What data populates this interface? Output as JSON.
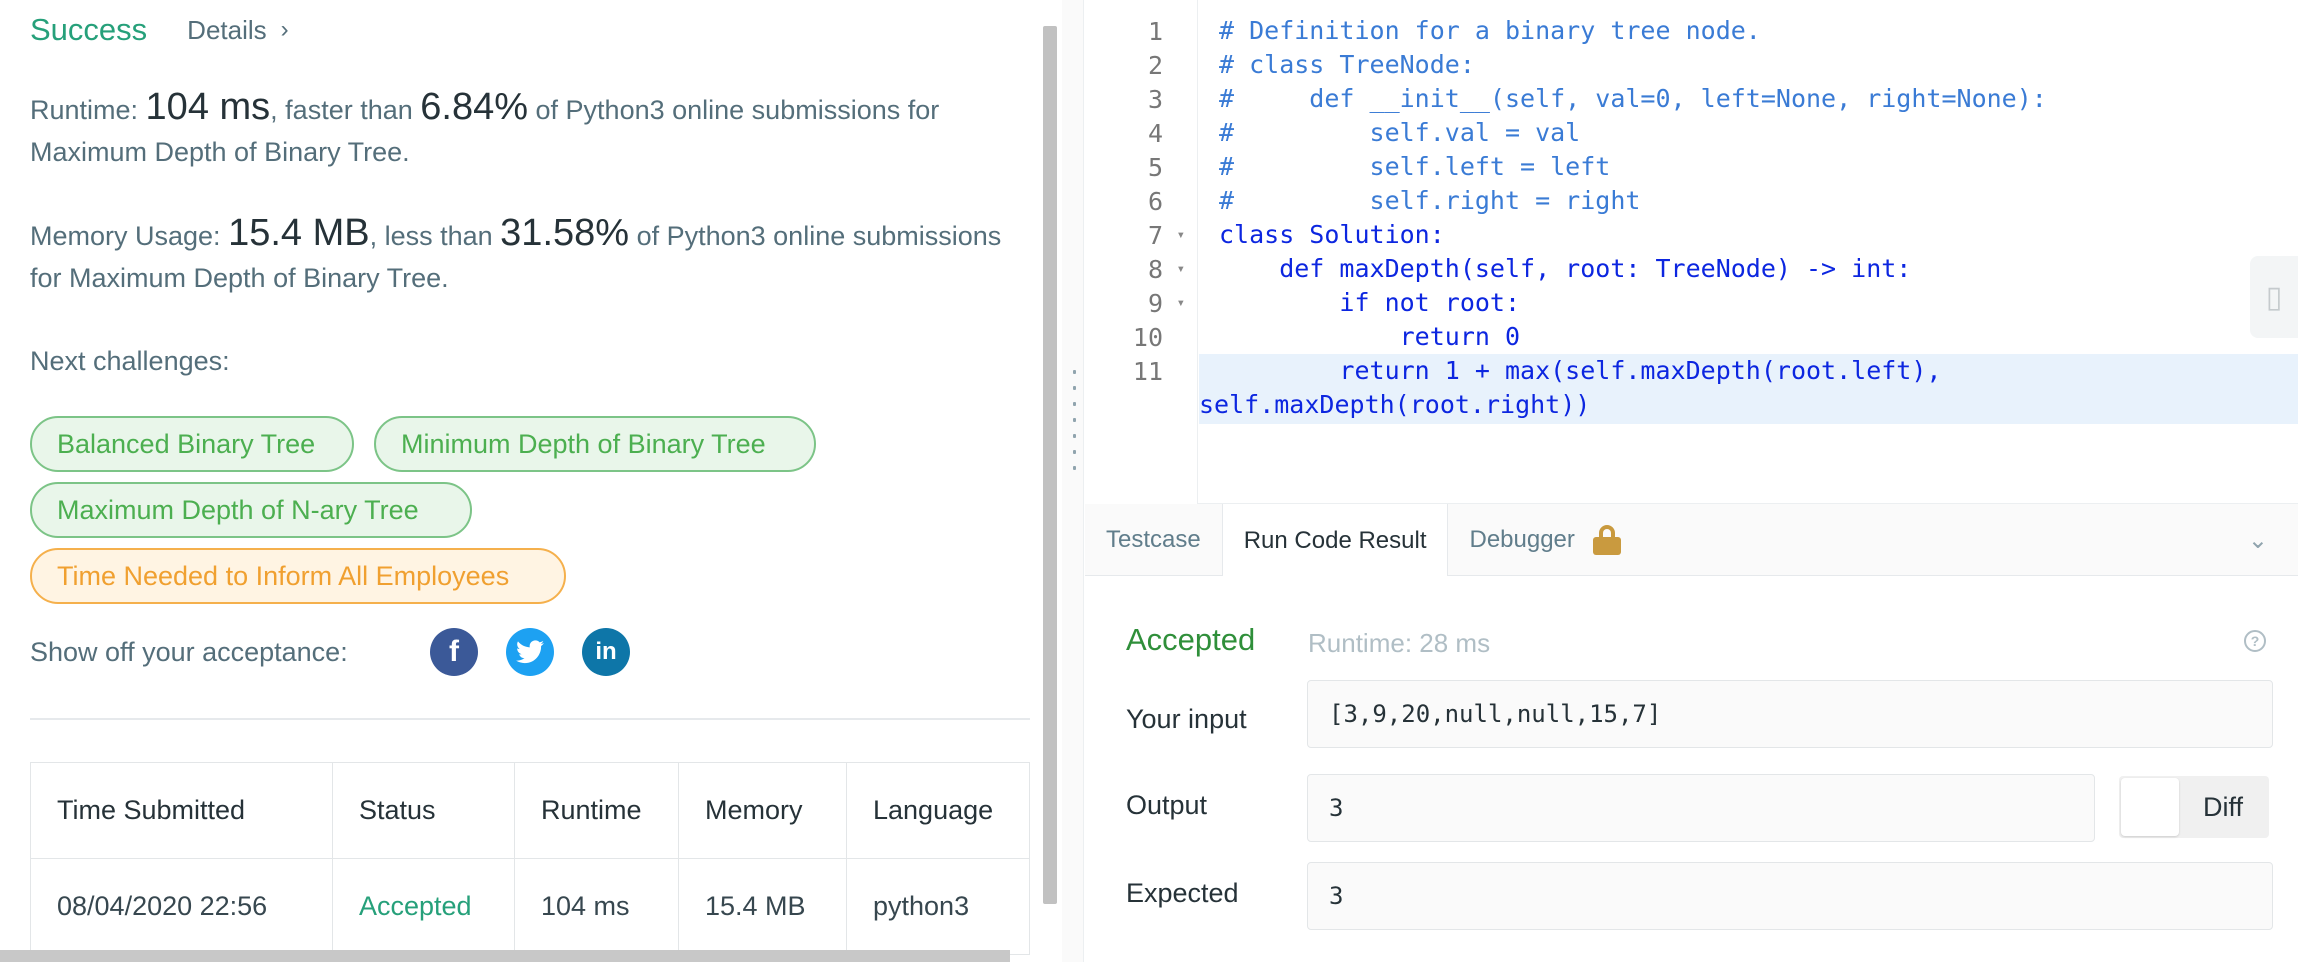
{
  "submission": {
    "status": "Success",
    "details_label": "Details",
    "details_chevron": "›",
    "runtime_label": "Runtime: ",
    "runtime_value": "104 ms",
    "runtime_mid": ", faster than ",
    "runtime_percent": "6.84%",
    "runtime_tail": " of Python3 online submissions for Maximum Depth of Binary Tree.",
    "memory_label": "Memory Usage: ",
    "memory_value": "15.4 MB",
    "memory_mid": ", less than ",
    "memory_percent": "31.58%",
    "memory_tail": " of Python3 online submissions for Maximum Depth of Binary Tree.",
    "next_label": "Next challenges:",
    "challenges": [
      {
        "label": "Balanced Binary Tree",
        "difficulty_color": "green"
      },
      {
        "label": "Minimum Depth of Binary Tree",
        "difficulty_color": "green"
      },
      {
        "label": "Maximum Depth of N-ary Tree",
        "difficulty_color": "green"
      },
      {
        "label": "Time Needed to Inform All Employees",
        "difficulty_color": "orange"
      }
    ],
    "share_label": "Show off your acceptance:",
    "share_icons": [
      "facebook-icon",
      "twitter-icon",
      "linkedin-icon"
    ]
  },
  "history_table": {
    "headers": [
      "Time Submitted",
      "Status",
      "Runtime",
      "Memory",
      "Language"
    ],
    "rows": [
      [
        "08/04/2020 22:56",
        "Accepted",
        "104 ms",
        "15.4 MB",
        "python3"
      ]
    ]
  },
  "editor": {
    "line_numbers": [
      "1",
      "2",
      "3",
      "4",
      "5",
      "6",
      "7",
      "8",
      "9",
      "10",
      "11"
    ],
    "fold_markers": [
      "",
      "",
      "",
      "",
      "",
      "",
      "▾",
      "▾",
      "▾",
      "",
      ""
    ],
    "lines": [
      "# Definition for a binary tree node.",
      "# class TreeNode:",
      "#     def __init__(self, val=0, left=None, right=None):",
      "#         self.val = val",
      "#         self.left = left",
      "#         self.right = right",
      "class Solution:",
      "    def maxDepth(self, root: TreeNode) -> int:",
      "        if not root:",
      "            return 0",
      "        return 1 + max(self.maxDepth(root.left),",
      "self.maxDepth(root.right))"
    ]
  },
  "console": {
    "tabs": [
      "Testcase",
      "Run Code Result",
      "Debugger"
    ],
    "active_tab": "Run Code Result",
    "result_status": "Accepted",
    "result_runtime": "Runtime: 28 ms",
    "input_label": "Your input",
    "input_value": "[3,9,20,null,null,15,7]",
    "output_label": "Output",
    "output_value": "3",
    "expected_label": "Expected",
    "expected_value": "3",
    "diff_label": "Diff"
  },
  "colors": {
    "success": "#26a07a",
    "accepted": "#2f8f3a",
    "chip_green": "#4caf50",
    "chip_orange": "#f0a030"
  }
}
